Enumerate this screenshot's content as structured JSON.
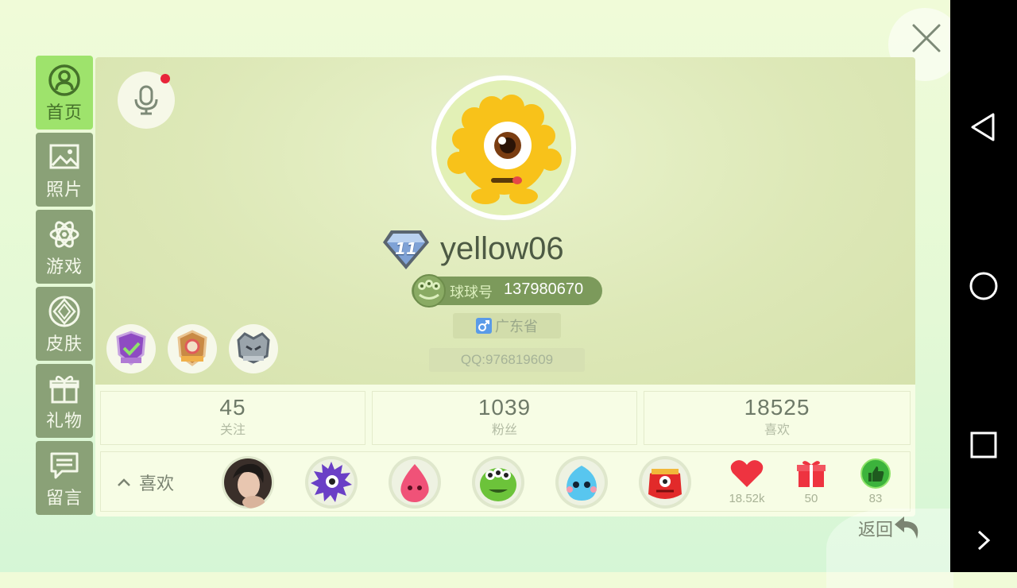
{
  "sidebar": {
    "items": [
      {
        "label": "首页",
        "icon": "user-circle-icon",
        "active": true
      },
      {
        "label": "照片",
        "icon": "photo-icon",
        "active": false
      },
      {
        "label": "游戏",
        "icon": "atom-icon",
        "active": false
      },
      {
        "label": "皮肤",
        "icon": "gem-icon",
        "active": false
      },
      {
        "label": "礼物",
        "icon": "gift-icon",
        "active": false
      },
      {
        "label": "留言",
        "icon": "message-icon",
        "active": false
      }
    ]
  },
  "profile": {
    "level": "11",
    "username": "yellow06",
    "id_label": "球球号",
    "id_number": "137980670",
    "location": "广东省",
    "qq": "QQ:976819609"
  },
  "stats": [
    {
      "value": "45",
      "label": "关注"
    },
    {
      "value": "1039",
      "label": "粉丝"
    },
    {
      "value": "18525",
      "label": "喜欢"
    }
  ],
  "likes": {
    "toggle_label": "喜欢",
    "hearts": "18.52k",
    "gifts": "50",
    "thumbs": "83"
  },
  "back_label": "返回",
  "colors": {
    "active_tab": "#9ee36c",
    "tab": "#8aa177",
    "accent_red": "#ee3340"
  }
}
